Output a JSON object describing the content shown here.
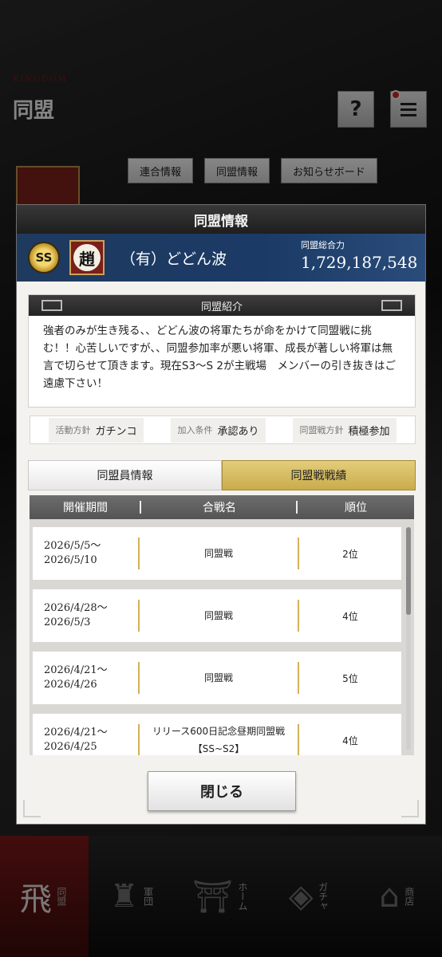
{
  "app": {
    "kingdom_text": "KINGDOM",
    "page_title": "同盟",
    "help_label": "?",
    "bg_tabs": [
      "連合情報",
      "同盟情報",
      "お知らせボード"
    ]
  },
  "modal": {
    "title": "同盟情報",
    "alliance": {
      "rank_badge": "SS",
      "emblem_char": "趙",
      "name": "（有）どどん波",
      "power_label": "同盟総合力",
      "power_value": "1,729,187,548"
    },
    "intro": {
      "title": "同盟紹介",
      "text": "強者のみが生き残る、、どどん波の将軍たちが命をかけて同盟戦に挑む！！心苦しいですが、、同盟参加率が悪い将軍、成長が著しい将軍は無言で切らせて頂きます。現在S3～S 2が主戦場　メンバーの引き抜きはご遠慮下さい！"
    },
    "policies": [
      {
        "label": "活動方針",
        "value": "ガチンコ"
      },
      {
        "label": "加入条件",
        "value": "承認あり"
      },
      {
        "label": "同盟戦方針",
        "value": "積極参加"
      }
    ],
    "tabs": [
      {
        "label": "同盟員情報",
        "active": false
      },
      {
        "label": "同盟戦戦績",
        "active": true
      }
    ],
    "table": {
      "headers": [
        "開催期間",
        "合戦名",
        "順位"
      ],
      "rows": [
        {
          "start": "2026/5/5～",
          "end": "2026/5/10",
          "battle": "同盟戦",
          "rank": "2位"
        },
        {
          "start": "2026/4/28～",
          "end": "2026/5/3",
          "battle": "同盟戦",
          "rank": "4位"
        },
        {
          "start": "2026/4/21～",
          "end": "2026/4/26",
          "battle": "同盟戦",
          "rank": "5位"
        },
        {
          "start": "2026/4/21～",
          "end": "2026/4/25",
          "battle": "リリース600日記念昼期同盟戦【SS~S2】",
          "rank": "4位"
        }
      ]
    },
    "close_label": "閉じる"
  },
  "nav": [
    {
      "label": "同盟",
      "icon": "flag-icon",
      "glyph": "飛",
      "active": true
    },
    {
      "label": "軍団",
      "icon": "helmet-icon",
      "glyph": "♜",
      "active": false
    },
    {
      "label": "ホーム",
      "icon": "castle-icon",
      "glyph": "⛩",
      "active": false
    },
    {
      "label": "ガチャ",
      "icon": "gacha-icon",
      "glyph": "◈",
      "active": false
    },
    {
      "label": "商店",
      "icon": "shop-icon",
      "glyph": "⌂",
      "active": false
    }
  ],
  "colors": {
    "banner": "#1f3a5f",
    "tab_active": "#d8bd5f",
    "nav_active": "#7a1818"
  }
}
